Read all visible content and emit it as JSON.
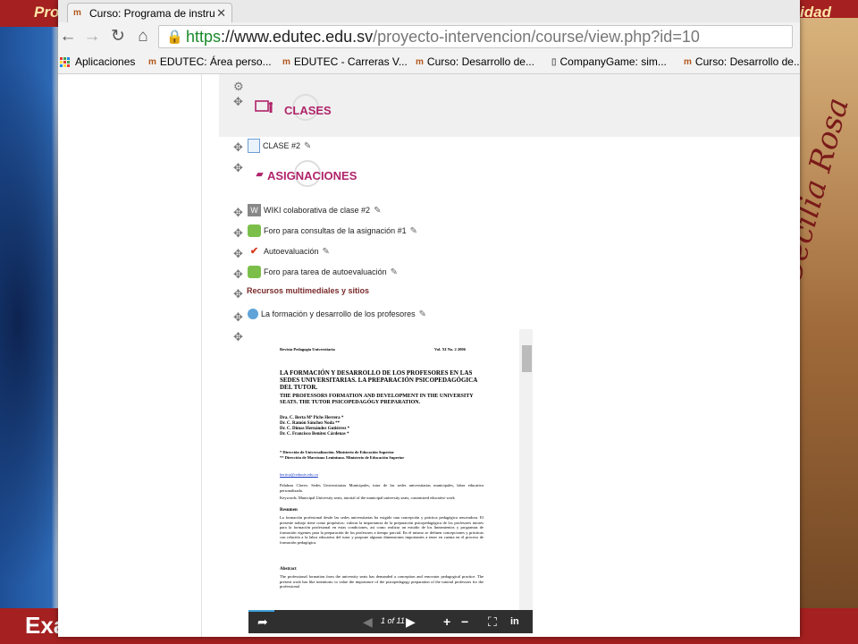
{
  "slide": {
    "top_title": "Pro",
    "top_right": "sidad",
    "bottom_text": "Exa",
    "script_signature": "María Cecilia Rosa"
  },
  "browser": {
    "tab_title": "Curso: Programa de instru",
    "tab_favicon": "moodle-icon",
    "url_https": "https",
    "url_host": "://www.edutec.edu.sv",
    "url_path": "/proyecto-intervencion/course/view.php?id=10",
    "bookmarks": [
      {
        "label": "Aplicaciones",
        "icon": "apps-icon"
      },
      {
        "label": "EDUTEC: Área perso...",
        "icon": "moodle-icon"
      },
      {
        "label": "EDUTEC - Carreras V...",
        "icon": "moodle-icon"
      },
      {
        "label": "Curso: Desarrollo de...",
        "icon": "moodle-icon"
      },
      {
        "label": "CompanyGame: sim...",
        "icon": "page-icon"
      },
      {
        "label": "Curso: Desarrollo de...",
        "icon": "moodle-icon"
      }
    ]
  },
  "course": {
    "section_clases": "CLASES",
    "section_asignaciones": "ASIGNACIONES",
    "activities": {
      "clase2": "CLASE #2",
      "wiki": "WIKI colaborativa de clase #2",
      "foro1": "Foro para consultas de la asignación #1",
      "autoeval": "Autoevaluación",
      "foro_auto": "Foro para tarea de autoevaluación",
      "formacion": "La formación y desarrollo de los profesores"
    },
    "resources_label": "Recursos  multimediales y  sitios"
  },
  "document": {
    "journal": "Revista Pedagogía Universitaria",
    "volume": "Vol. XI No. 2 2006",
    "title": "LA FORMACIÓN Y DESARROLLO DE LOS PROFESORES EN LAS SEDES UNIVERSITARIAS. LA PREPARACIÓN PSICOPEDAGÓGICA DEL TUTOR.",
    "subtitle": "THE PROFESSORS FORMATION AND DEVELOPMENT IN THE UNIVERSITY SEATS. THE TUTOR PSICOPEDAGÓGY PREPARATION.",
    "author1": "Dra. C. Berta Mª Pichs Herrera *",
    "author2": "Dr. C. Ramón Sánchez Noda **",
    "author3": "Dr. C. Dimas Hernández Gutiérrez *",
    "author4": "Dr. C. Francisco Benítez Cárdenas *",
    "affil1": "* Dirección de Universalización. Ministerio de Educación Superior",
    "affil2": "** Dirección de Marxismo Leninismo. Ministerio de Educación Superior",
    "email": "bertica@reduniv.edu.cu",
    "keywords_es": "Palabras Claves: Sedes Universitarias Municipales,  tutor de las sedes universitarias municipales, labor educativa personalizada.",
    "keywords_en": "Keywords: Municipal University seats, tutorial of the municipal university seats, customized educative work",
    "resumen_head": "Resumen",
    "resumen": "La formación profesional desde las sedes universitarias ha exigido una concepción y práctica pedagógica renovadora. El presente trabajo tiene como propósitos: valorar la importancia de la preparación psicopedagógica de los profesores tutores para la formación profesional en estas  condiciones, así como realizar un estudio  de los lineamientos y programas de formación vigentes para la preparación de los profesores a tiempo parcial. En el  mismo se definen concepciones y prácticas con relación a la labor educativa del tutor y propone algunas dimensiones  importantes a tener en cuenta en el proceso de formación pedagógica.",
    "abstract_head": "Abstract",
    "abstract": "The professional formation from the university seats has demanded a conception and renovator pedagogical practice. The present work has like intentions: to value the importance of the psicopedagogy preparation of the tutorial professors for the professional",
    "page_indicator": "1 of 11",
    "progress": 0.09
  }
}
